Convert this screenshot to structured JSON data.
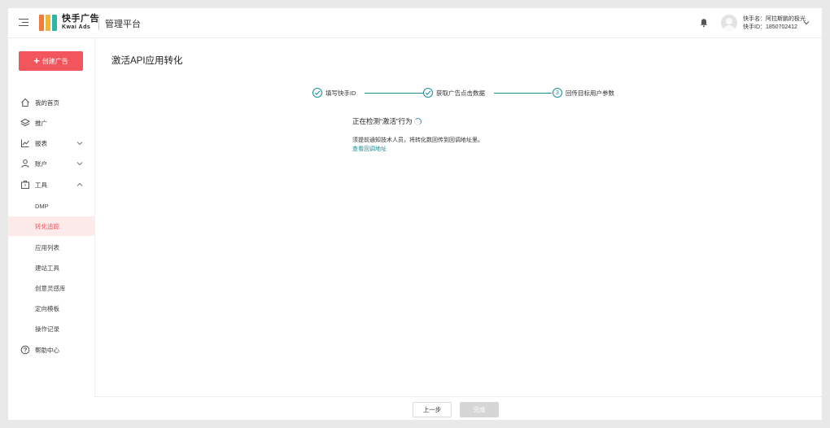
{
  "brand": {
    "logo_cn": "快手广告",
    "logo_en": "Kwai Ads",
    "platform_title": "管理平台",
    "logo_colors": [
      "#f27b3a",
      "#f2b435",
      "#2fb4a8"
    ]
  },
  "header": {
    "user_name_line": "快手名：阿拉斯鹏的极光",
    "user_id_line": "快手ID：1850702412",
    "icons": [
      "menu-toggle-icon",
      "bell-icon",
      "chevron-down-icon"
    ]
  },
  "sidebar": {
    "create_label": "创建广告",
    "items": [
      {
        "label": "我的首页",
        "icon": "home-icon"
      },
      {
        "label": "推广",
        "icon": "layers-icon"
      },
      {
        "label": "报表",
        "icon": "chart-icon"
      },
      {
        "label": "账户",
        "icon": "account-icon"
      },
      {
        "label": "工具",
        "icon": "toolbox-icon"
      }
    ],
    "tool_sub_items": [
      "DMP",
      "转化追踪",
      "应用列表",
      "建站工具",
      "创意灵感库",
      "定向模板",
      "操作记录"
    ],
    "active_sub_item": "转化追踪",
    "help_label": "帮助中心"
  },
  "main": {
    "title": "激活API应用转化",
    "steps": [
      {
        "label": "填写快手ID",
        "status": "done"
      },
      {
        "label": "获取广告点击数据",
        "status": "done"
      },
      {
        "label": "回传目标用户参数",
        "status": "current",
        "number": "3"
      }
    ],
    "status_text": "正在检测“激活”行为",
    "hint_text": "须提前通知技术人员，将转化数回传到回调地址里。",
    "link_text": "查看回调地址"
  },
  "footer": {
    "prev_label": "上一步",
    "done_label": "完成"
  },
  "colors": {
    "accent_red": "#f2555c",
    "accent_teal": "#1a8f95",
    "link_blue": "#3a8fc9"
  }
}
